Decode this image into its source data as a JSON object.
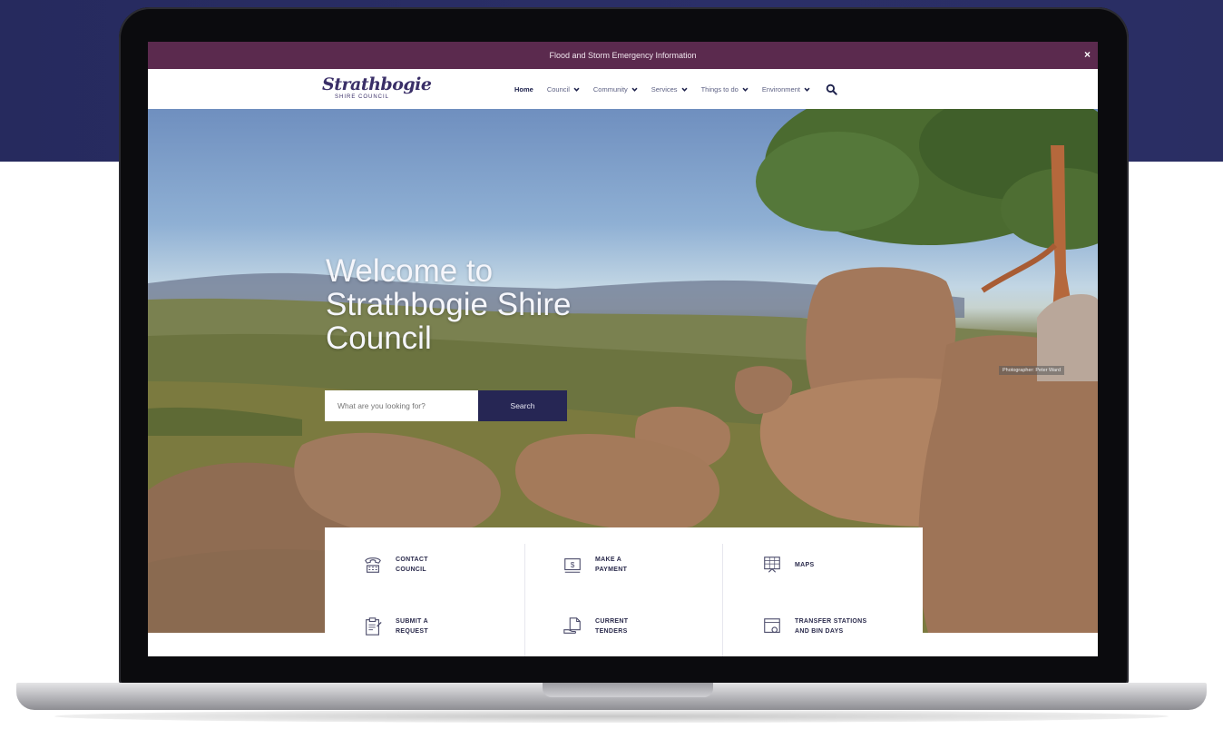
{
  "alert": {
    "text": "Flood and Storm Emergency Information",
    "close": "×"
  },
  "logo": {
    "name": "Strathbogie",
    "subtitle": "SHIRE COUNCIL"
  },
  "nav": {
    "items": [
      {
        "label": "Home",
        "active": true
      },
      {
        "label": "Council"
      },
      {
        "label": "Community"
      },
      {
        "label": "Services"
      },
      {
        "label": "Things to do"
      },
      {
        "label": "Environment"
      }
    ]
  },
  "hero": {
    "title": "Welcome to Strathbogie Shire Council",
    "search_placeholder": "What are you looking for?",
    "search_button": "Search",
    "photo_credit": "Photographer: Peter Ward"
  },
  "quick_links": [
    {
      "line1": "CONTACT",
      "line2": "COUNCIL",
      "icon": "phone-icon"
    },
    {
      "line1": "MAKE A",
      "line2": "PAYMENT",
      "icon": "payment-icon"
    },
    {
      "line1": "MAPS",
      "line2": "",
      "icon": "map-icon"
    },
    {
      "line1": "SUBMIT A",
      "line2": "REQUEST",
      "icon": "clipboard-icon"
    },
    {
      "line1": "CURRENT",
      "line2": "TENDERS",
      "icon": "document-hand-icon"
    },
    {
      "line1": "TRANSFER STATIONS",
      "line2": "AND BIN DAYS",
      "icon": "bin-icon"
    }
  ],
  "colors": {
    "alert_bar": "#5b2a4e",
    "brand": "#3a2f68",
    "search_button": "#262654",
    "background_top": "#2b2f68"
  }
}
